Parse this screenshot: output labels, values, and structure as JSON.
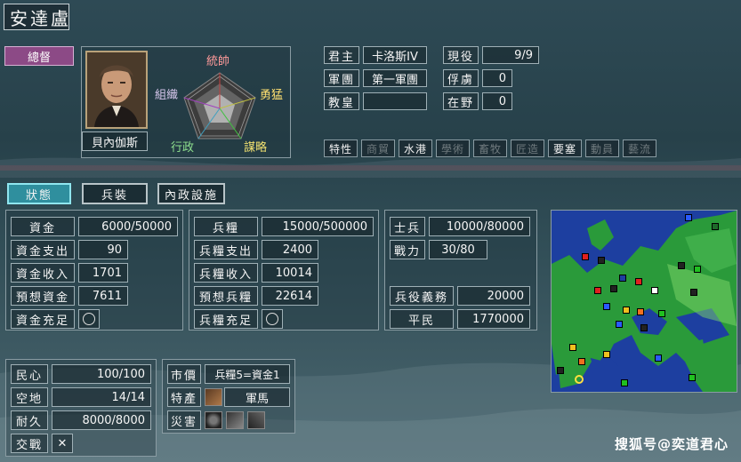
{
  "header": {
    "city_name": "安達盧",
    "rank": "總督"
  },
  "general": {
    "name": "貝內伽斯",
    "hex": {
      "top": "統帥",
      "left": "組織",
      "right": "勇猛",
      "bottom_left": "行政",
      "bottom_right": "謀略"
    }
  },
  "info": {
    "lord_label": "君主",
    "lord_value": "卡洛斯IV",
    "army_label": "軍團",
    "army_value": "第一軍團",
    "pope_label": "教皇",
    "pope_value": "",
    "active_label": "現役",
    "active_value": "9/9",
    "captive_label": "俘虜",
    "captive_value": "0",
    "wild_label": "在野",
    "wild_value": "0"
  },
  "traits": {
    "header": "特性",
    "items": [
      {
        "label": "商貿",
        "active": false
      },
      {
        "label": "水港",
        "active": true
      },
      {
        "label": "學術",
        "active": false
      },
      {
        "label": "畜牧",
        "active": false
      },
      {
        "label": "匠造",
        "active": false
      },
      {
        "label": "要塞",
        "active": true
      },
      {
        "label": "動員",
        "active": false
      },
      {
        "label": "藝流",
        "active": false
      }
    ]
  },
  "tabs": [
    {
      "label": "狀態",
      "active": true
    },
    {
      "label": "兵裝",
      "active": false
    },
    {
      "label": "內政設施",
      "active": false
    }
  ],
  "funds": {
    "funds_label": "資金",
    "funds_value": "6000/50000",
    "expense_label": "資金支出",
    "expense_value": "90",
    "income_label": "資金收入",
    "income_value": "1701",
    "forecast_label": "預想資金",
    "forecast_value": "7611",
    "enough_label": "資金充足"
  },
  "provisions": {
    "prov_label": "兵糧",
    "prov_value": "15000/500000",
    "expense_label": "兵糧支出",
    "expense_value": "2400",
    "income_label": "兵糧收入",
    "income_value": "10014",
    "forecast_label": "預想兵糧",
    "forecast_value": "22614",
    "enough_label": "兵糧充足"
  },
  "military": {
    "soldiers_label": "士兵",
    "soldiers_value": "10000/80000",
    "power_label": "戰力",
    "power_value": "30/80",
    "duty_label": "兵役義務",
    "duty_value": "20000",
    "civilians_label": "平民",
    "civilians_value": "1770000"
  },
  "city": {
    "morale_label": "民心",
    "morale_value": "100/100",
    "land_label": "空地",
    "land_value": "14/14",
    "durability_label": "耐久",
    "durability_value": "8000/8000",
    "battle_label": "交戰",
    "battle_value": "✕"
  },
  "market": {
    "price_label": "市價",
    "price_value": "兵糧5=資金1",
    "specialty_label": "特產",
    "specialty_value": "軍馬",
    "disaster_label": "災害"
  },
  "watermark": "搜狐号@奕道君心",
  "colors": {
    "accent_tab": "#2f8f9e",
    "rank_bg": "#8c4a86",
    "map_sea": "#1d3fa0",
    "map_land": "#2a9a3a"
  }
}
